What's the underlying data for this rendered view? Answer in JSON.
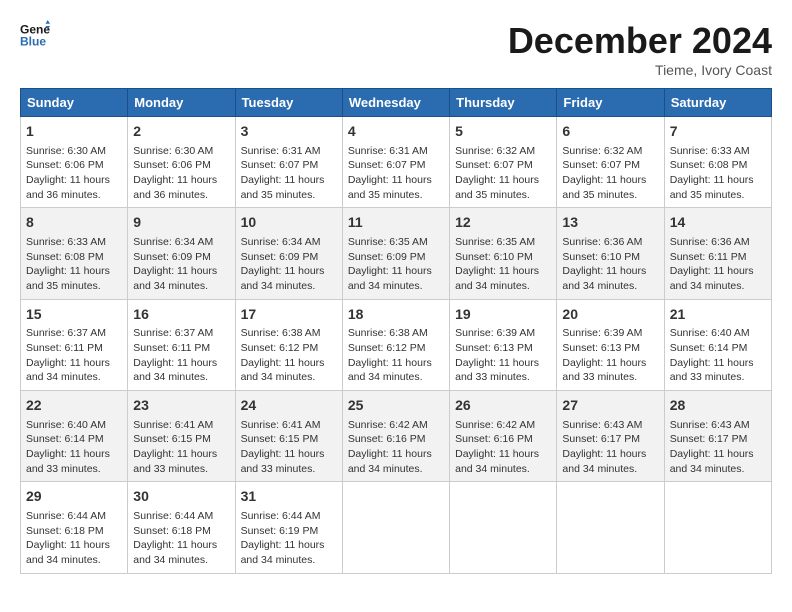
{
  "header": {
    "logo_line1": "General",
    "logo_line2": "Blue",
    "month": "December 2024",
    "location": "Tieme, Ivory Coast"
  },
  "days_of_week": [
    "Sunday",
    "Monday",
    "Tuesday",
    "Wednesday",
    "Thursday",
    "Friday",
    "Saturday"
  ],
  "weeks": [
    [
      {
        "day": "1",
        "info": "Sunrise: 6:30 AM\nSunset: 6:06 PM\nDaylight: 11 hours\nand 36 minutes."
      },
      {
        "day": "2",
        "info": "Sunrise: 6:30 AM\nSunset: 6:06 PM\nDaylight: 11 hours\nand 36 minutes."
      },
      {
        "day": "3",
        "info": "Sunrise: 6:31 AM\nSunset: 6:07 PM\nDaylight: 11 hours\nand 35 minutes."
      },
      {
        "day": "4",
        "info": "Sunrise: 6:31 AM\nSunset: 6:07 PM\nDaylight: 11 hours\nand 35 minutes."
      },
      {
        "day": "5",
        "info": "Sunrise: 6:32 AM\nSunset: 6:07 PM\nDaylight: 11 hours\nand 35 minutes."
      },
      {
        "day": "6",
        "info": "Sunrise: 6:32 AM\nSunset: 6:07 PM\nDaylight: 11 hours\nand 35 minutes."
      },
      {
        "day": "7",
        "info": "Sunrise: 6:33 AM\nSunset: 6:08 PM\nDaylight: 11 hours\nand 35 minutes."
      }
    ],
    [
      {
        "day": "8",
        "info": "Sunrise: 6:33 AM\nSunset: 6:08 PM\nDaylight: 11 hours\nand 35 minutes."
      },
      {
        "day": "9",
        "info": "Sunrise: 6:34 AM\nSunset: 6:09 PM\nDaylight: 11 hours\nand 34 minutes."
      },
      {
        "day": "10",
        "info": "Sunrise: 6:34 AM\nSunset: 6:09 PM\nDaylight: 11 hours\nand 34 minutes."
      },
      {
        "day": "11",
        "info": "Sunrise: 6:35 AM\nSunset: 6:09 PM\nDaylight: 11 hours\nand 34 minutes."
      },
      {
        "day": "12",
        "info": "Sunrise: 6:35 AM\nSunset: 6:10 PM\nDaylight: 11 hours\nand 34 minutes."
      },
      {
        "day": "13",
        "info": "Sunrise: 6:36 AM\nSunset: 6:10 PM\nDaylight: 11 hours\nand 34 minutes."
      },
      {
        "day": "14",
        "info": "Sunrise: 6:36 AM\nSunset: 6:11 PM\nDaylight: 11 hours\nand 34 minutes."
      }
    ],
    [
      {
        "day": "15",
        "info": "Sunrise: 6:37 AM\nSunset: 6:11 PM\nDaylight: 11 hours\nand 34 minutes."
      },
      {
        "day": "16",
        "info": "Sunrise: 6:37 AM\nSunset: 6:11 PM\nDaylight: 11 hours\nand 34 minutes."
      },
      {
        "day": "17",
        "info": "Sunrise: 6:38 AM\nSunset: 6:12 PM\nDaylight: 11 hours\nand 34 minutes."
      },
      {
        "day": "18",
        "info": "Sunrise: 6:38 AM\nSunset: 6:12 PM\nDaylight: 11 hours\nand 34 minutes."
      },
      {
        "day": "19",
        "info": "Sunrise: 6:39 AM\nSunset: 6:13 PM\nDaylight: 11 hours\nand 33 minutes."
      },
      {
        "day": "20",
        "info": "Sunrise: 6:39 AM\nSunset: 6:13 PM\nDaylight: 11 hours\nand 33 minutes."
      },
      {
        "day": "21",
        "info": "Sunrise: 6:40 AM\nSunset: 6:14 PM\nDaylight: 11 hours\nand 33 minutes."
      }
    ],
    [
      {
        "day": "22",
        "info": "Sunrise: 6:40 AM\nSunset: 6:14 PM\nDaylight: 11 hours\nand 33 minutes."
      },
      {
        "day": "23",
        "info": "Sunrise: 6:41 AM\nSunset: 6:15 PM\nDaylight: 11 hours\nand 33 minutes."
      },
      {
        "day": "24",
        "info": "Sunrise: 6:41 AM\nSunset: 6:15 PM\nDaylight: 11 hours\nand 33 minutes."
      },
      {
        "day": "25",
        "info": "Sunrise: 6:42 AM\nSunset: 6:16 PM\nDaylight: 11 hours\nand 34 minutes."
      },
      {
        "day": "26",
        "info": "Sunrise: 6:42 AM\nSunset: 6:16 PM\nDaylight: 11 hours\nand 34 minutes."
      },
      {
        "day": "27",
        "info": "Sunrise: 6:43 AM\nSunset: 6:17 PM\nDaylight: 11 hours\nand 34 minutes."
      },
      {
        "day": "28",
        "info": "Sunrise: 6:43 AM\nSunset: 6:17 PM\nDaylight: 11 hours\nand 34 minutes."
      }
    ],
    [
      {
        "day": "29",
        "info": "Sunrise: 6:44 AM\nSunset: 6:18 PM\nDaylight: 11 hours\nand 34 minutes."
      },
      {
        "day": "30",
        "info": "Sunrise: 6:44 AM\nSunset: 6:18 PM\nDaylight: 11 hours\nand 34 minutes."
      },
      {
        "day": "31",
        "info": "Sunrise: 6:44 AM\nSunset: 6:19 PM\nDaylight: 11 hours\nand 34 minutes."
      },
      {
        "day": "",
        "info": ""
      },
      {
        "day": "",
        "info": ""
      },
      {
        "day": "",
        "info": ""
      },
      {
        "day": "",
        "info": ""
      }
    ]
  ]
}
